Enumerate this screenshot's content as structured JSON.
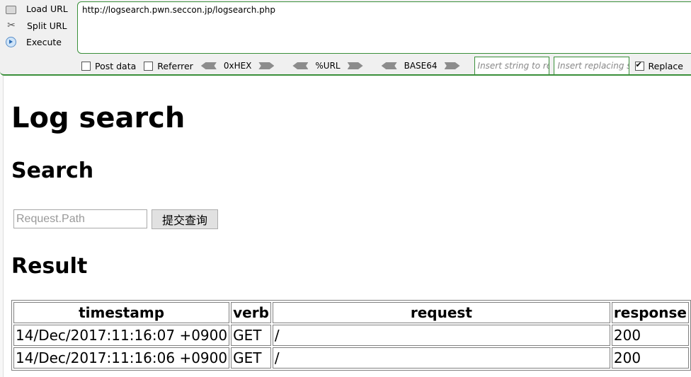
{
  "hackbar": {
    "load_url": "Load URL",
    "split_url": "Split URL",
    "execute": "Execute",
    "url": "http://logsearch.pwn.seccon.jp/logsearch.php",
    "post_data": "Post data",
    "referrer": "Referrer",
    "hex": "0xHEX",
    "url_enc": "%URL",
    "base64": "BASE64",
    "replace_find_placeholder": "Insert string to replace",
    "replace_with_placeholder": "Insert replacing string",
    "replace_label": "Replace",
    "accent_color": "#3a8f3a"
  },
  "page": {
    "title": "Log search",
    "search_heading": "Search",
    "search_placeholder": "Request.Path",
    "submit_label": "提交查询",
    "result_heading": "Result",
    "table": {
      "headers": [
        "timestamp",
        "verb",
        "request",
        "response"
      ],
      "rows": [
        [
          "14/Dec/2017:11:16:07 +0900",
          "GET",
          "/",
          "200"
        ],
        [
          "14/Dec/2017:11:16:06 +0900",
          "GET",
          "/",
          "200"
        ]
      ]
    }
  }
}
